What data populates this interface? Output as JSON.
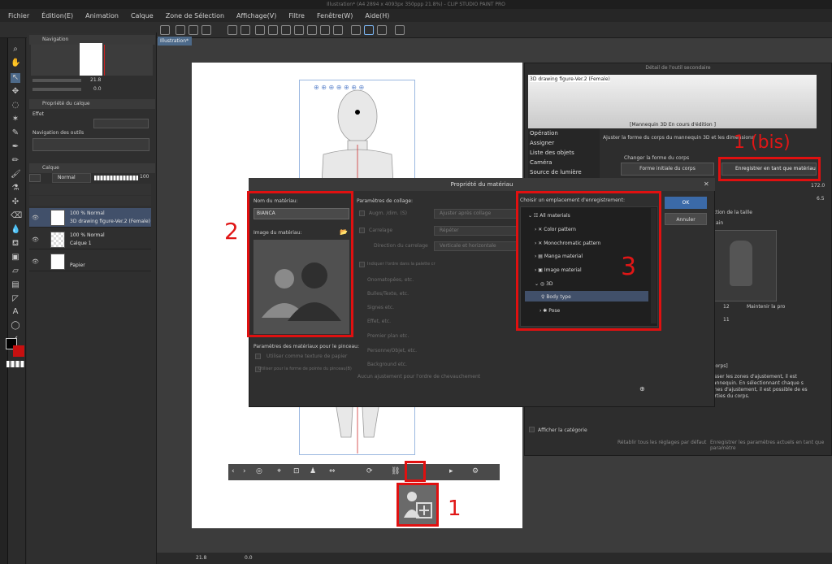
{
  "window_title": "Illustration* (A4 2894 x 4093px 350ppp 21.8%) - CLIP STUDIO PAINT PRO",
  "menu": [
    "Fichier",
    "Édition(E)",
    "Animation",
    "Calque",
    "Zone de Sélection",
    "Affichage(V)",
    "Filtre",
    "Fenêtre(W)",
    "Aide(H)"
  ],
  "document_tab": "Illustration*",
  "left_panel": {
    "navigation_tab": "Navigation",
    "zoom": "21.8",
    "rotation": "0.0",
    "layer_property_tab": "Propriété du calque",
    "effect_label": "Effet",
    "tool_nav_label": "Navigation des outils",
    "layer_tab": "Calque",
    "blend_mode": "Normal",
    "opacity": "100",
    "layers": [
      {
        "line1": "100 % Normal",
        "line2": "3D drawing figure-Ver.2 (Female)"
      },
      {
        "line1": "100 % Normal",
        "line2": "Calque 1"
      },
      {
        "line1": "",
        "line2": "Papier"
      }
    ]
  },
  "subtool_panel": {
    "title": "Détail de l'outil secondaire",
    "model_name": "3D drawing figure-Ver.2 (Female)",
    "editing_label": "[Mannequin 3D En cours d'édition ]",
    "categories": [
      "Opération",
      "Assigner",
      "Liste des objets",
      "Caméra",
      "Source de lumière"
    ],
    "description": "Ajuster la forme du corps du mannequin 3D et les dimensions",
    "change_shape_label": "Changer la forme du corps",
    "initial_shape_button": "Forme initiale du corps",
    "register_button": "Enregistrer en tant que matériau",
    "value_height": "172.0",
    "value_head": "6.5",
    "size_label": "nction de la taille",
    "hand_label": "ain",
    "value_12": "12",
    "keep_label": "Maintenir la pro",
    "value_11": "11",
    "info_title": "s corps]",
    "info_text": "glisser les zones d'ajustement, il est mannequin. En sélectionnant chaque s zones d'ajustement, il est possible de es parties du corps.",
    "show_category": "Afficher la catégorie",
    "reset_all": "Rétablir tous les réglages par défaut",
    "save_current": "Enregistrer les paramètres actuels en tant que paramètre",
    "ajout_label": "outils de recherche"
  },
  "dialog": {
    "title": "Propriété du matériau",
    "name_label": "Nom du matériau:",
    "name_value": "BIANCA",
    "image_label": "Image du matériau:",
    "brush_params_label": "Paramètres des matériaux pour le pinceau:",
    "paper_texture": "Utiliser comme texture de papier",
    "brush_tip": "Utiliser pour la forme de pointe du pinceau(B)",
    "paste_params": "Paramètres de collage:",
    "zoom_label": "Augm. /dim. (S)",
    "zoom_dd": "Ajuster après collage",
    "tiling": "Carrelage",
    "tiling_dd": "Répéter",
    "tile_dir": "Direction du carrelage",
    "tile_dir_dd": "Verticale et horizontale",
    "order_label": "Indiquer l'ordre dans la palette cr",
    "options": [
      "Onomatopées, etc.",
      "Bulles/Texte, etc.",
      "Signes etc.",
      "Effet, etc.",
      "Premier plan etc.",
      "Personne/Objet, etc.",
      "Background etc."
    ],
    "no_adjust": "Aucun ajustement pour l'ordre de chevauchement",
    "save_location_label": "Choisir un emplacement d'enregistrement:",
    "tree": [
      "All materials",
      "Color pattern",
      "Monochromatic pattern",
      "Manga material",
      "Image material",
      "3D",
      "Body type",
      "Pose"
    ],
    "ok": "OK",
    "cancel": "Annuler"
  },
  "status": {
    "zoom": "21.8",
    "angle": "0.0"
  },
  "annotations": {
    "one": "1",
    "one_bis": "1 (bis)",
    "two": "2",
    "three": "3"
  },
  "colors": {
    "annotation_red": "#e01010",
    "accent_blue": "#3b6aa8"
  }
}
